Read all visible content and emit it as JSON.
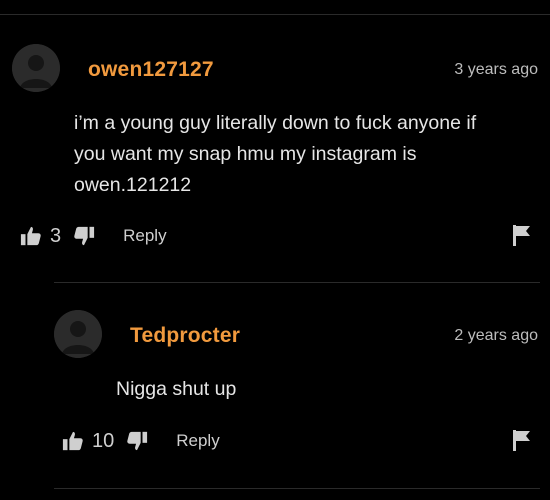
{
  "comments": [
    {
      "username": "owen127127",
      "timestamp": "3 years ago",
      "text": "i’m a young guy literally down to fuck anyone if\nyou want my snap hmu my instagram is\nowen.121212",
      "likes": "3",
      "reply_label": "Reply",
      "icons": {
        "avatar": "default-avatar-icon",
        "like": "thumbs-up-icon",
        "dislike": "thumbs-down-icon",
        "flag": "flag-icon"
      }
    },
    {
      "username": "Tedprocter",
      "timestamp": "2 years ago",
      "text": "Nigga shut up",
      "likes": "10",
      "reply_label": "Reply",
      "icons": {
        "avatar": "default-avatar-icon",
        "like": "thumbs-up-icon",
        "dislike": "thumbs-down-icon",
        "flag": "flag-icon"
      }
    }
  ],
  "colors": {
    "background": "#000000",
    "username": "#f19a3e",
    "text": "#e6e6e6",
    "muted": "#bdbdbd",
    "divider": "#2a2a2a"
  }
}
